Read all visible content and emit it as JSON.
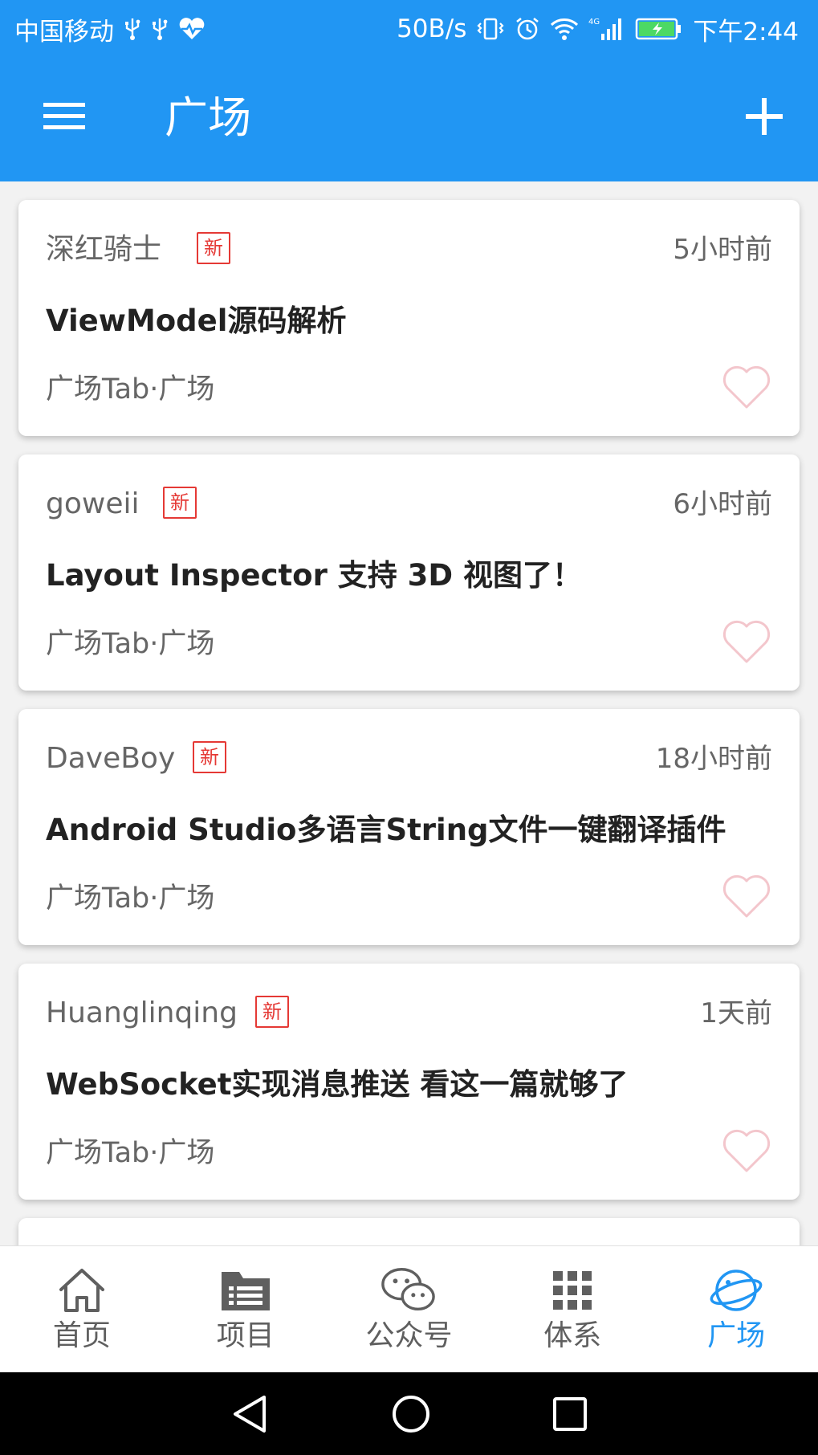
{
  "status_bar": {
    "carrier": "中国移动",
    "net_speed": "50B/s",
    "network_type": "4G",
    "time": "下午2:44",
    "icons": [
      "usb-icon",
      "usb-icon",
      "heart-monitor-icon",
      "vibrate-icon",
      "alarm-icon",
      "wifi-icon",
      "signal-icon",
      "battery-icon"
    ]
  },
  "app_bar": {
    "title": "广场",
    "menu_icon": "menu-icon",
    "add_icon": "plus-icon"
  },
  "badge_label": "新",
  "articles": [
    {
      "author": "深红骑士",
      "is_new": true,
      "time": "5小时前",
      "title": "ViewModel源码解析",
      "category": "广场Tab·广场",
      "liked": false
    },
    {
      "author": "goweii",
      "is_new": true,
      "time": "6小时前",
      "title": "Layout Inspector 支持 3D 视图了！",
      "category": "广场Tab·广场",
      "liked": false
    },
    {
      "author": "DaveBoy",
      "is_new": true,
      "time": "18小时前",
      "title": "Android Studio多语言String文件一键翻译插件",
      "category": "广场Tab·广场",
      "liked": false
    },
    {
      "author": "Huanglinqing",
      "is_new": true,
      "time": "1天前",
      "title": "WebSocket实现消息推送 看这一篇就够了",
      "category": "广场Tab·广场",
      "liked": false
    }
  ],
  "bottom_nav": [
    {
      "label": "首页",
      "icon": "home-icon",
      "active": false
    },
    {
      "label": "项目",
      "icon": "project-list-icon",
      "active": false
    },
    {
      "label": "公众号",
      "icon": "wechat-icon",
      "active": false
    },
    {
      "label": "体系",
      "icon": "grid-icon",
      "active": false
    },
    {
      "label": "广场",
      "icon": "planet-icon",
      "active": true
    }
  ],
  "colors": {
    "primary": "#2196f3",
    "badge": "#e53935",
    "like_outline": "#f3c6cc",
    "text_secondary": "#666666",
    "text_primary": "#222222",
    "nav_inactive": "#5f5f5f"
  }
}
